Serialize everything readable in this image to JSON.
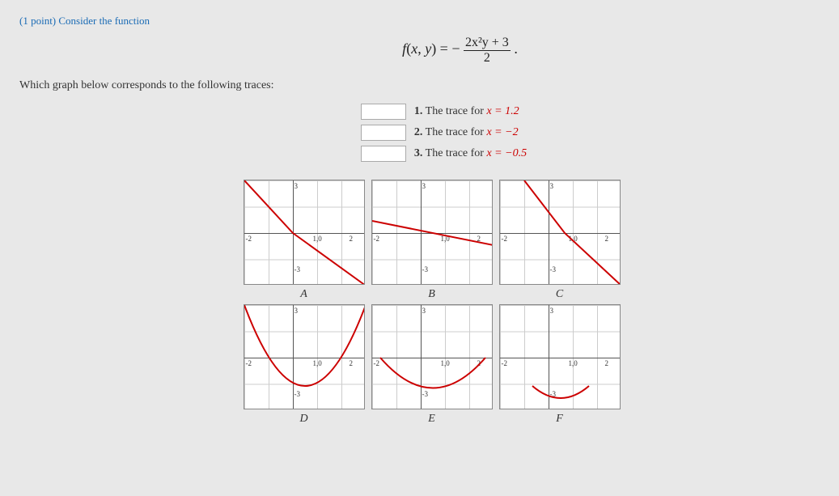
{
  "point_label": "(1 point) Consider the function",
  "function_text": "f(x, y) = −",
  "function_numerator": "2x²y + 3",
  "function_denominator": "2",
  "which_graph": "Which graph below corresponds to the following traces:",
  "traces": [
    {
      "number": "1.",
      "text": "The trace for ",
      "eq": "x = 1.2"
    },
    {
      "number": "2.",
      "text": "The trace for ",
      "eq": "x = −2"
    },
    {
      "number": "3.",
      "text": "The trace for ",
      "eq": "x = −0.5"
    }
  ],
  "graphs_top": [
    {
      "label": "A"
    },
    {
      "label": "B"
    },
    {
      "label": "C"
    }
  ],
  "graphs_bottom": [
    {
      "label": "D"
    },
    {
      "label": "E"
    },
    {
      "label": "F"
    }
  ],
  "axis_labels": {
    "x_pos": "2",
    "x_neg": "-2",
    "y_pos": "3",
    "y_neg": "-3",
    "x_mid": "1,0"
  }
}
